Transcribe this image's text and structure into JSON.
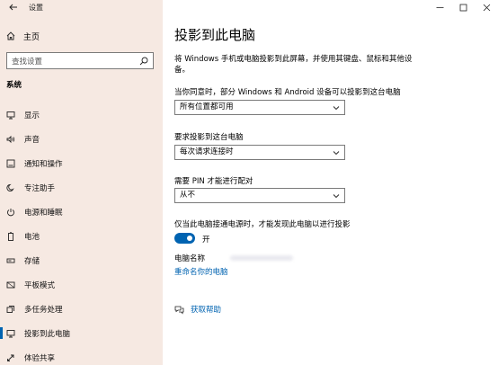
{
  "window": {
    "title": "设置"
  },
  "sidebar": {
    "home_label": "主页",
    "search_placeholder": "查找设置",
    "section_title": "系统",
    "items": [
      {
        "label": "显示",
        "icon": "display-icon"
      },
      {
        "label": "声音",
        "icon": "sound-icon"
      },
      {
        "label": "通知和操作",
        "icon": "notification-icon"
      },
      {
        "label": "专注助手",
        "icon": "focus-assist-icon"
      },
      {
        "label": "电源和睡眠",
        "icon": "power-icon"
      },
      {
        "label": "电池",
        "icon": "battery-icon"
      },
      {
        "label": "存储",
        "icon": "storage-icon"
      },
      {
        "label": "平板模式",
        "icon": "tablet-icon"
      },
      {
        "label": "多任务处理",
        "icon": "multitask-icon"
      },
      {
        "label": "投影到此电脑",
        "icon": "project-icon",
        "active": true
      },
      {
        "label": "体验共享",
        "icon": "shared-experience-icon"
      }
    ]
  },
  "main": {
    "title": "投影到此电脑",
    "description": "将 Windows 手机或电脑投影到此屏幕，并使用其键盘、鼠标和其他设备。",
    "setting1": {
      "label": "当你同意时，部分 Windows 和 Android 设备可以投影到这台电脑",
      "value": "所有位置都可用"
    },
    "setting2": {
      "label": "要求投影到这台电脑",
      "value": "每次请求连接时"
    },
    "setting3": {
      "label": "需要 PIN 才能进行配对",
      "value": "从不"
    },
    "setting4": {
      "label": "仅当此电脑接通电源时，才能发现此电脑以进行投影",
      "toggle_state": "开"
    },
    "pc_name_label": "电脑名称",
    "rename_link": "重命名你的电脑",
    "help_link": "获取帮助"
  },
  "colors": {
    "accent": "#0063b1",
    "sidebar_bg": "#f6e9e2"
  }
}
